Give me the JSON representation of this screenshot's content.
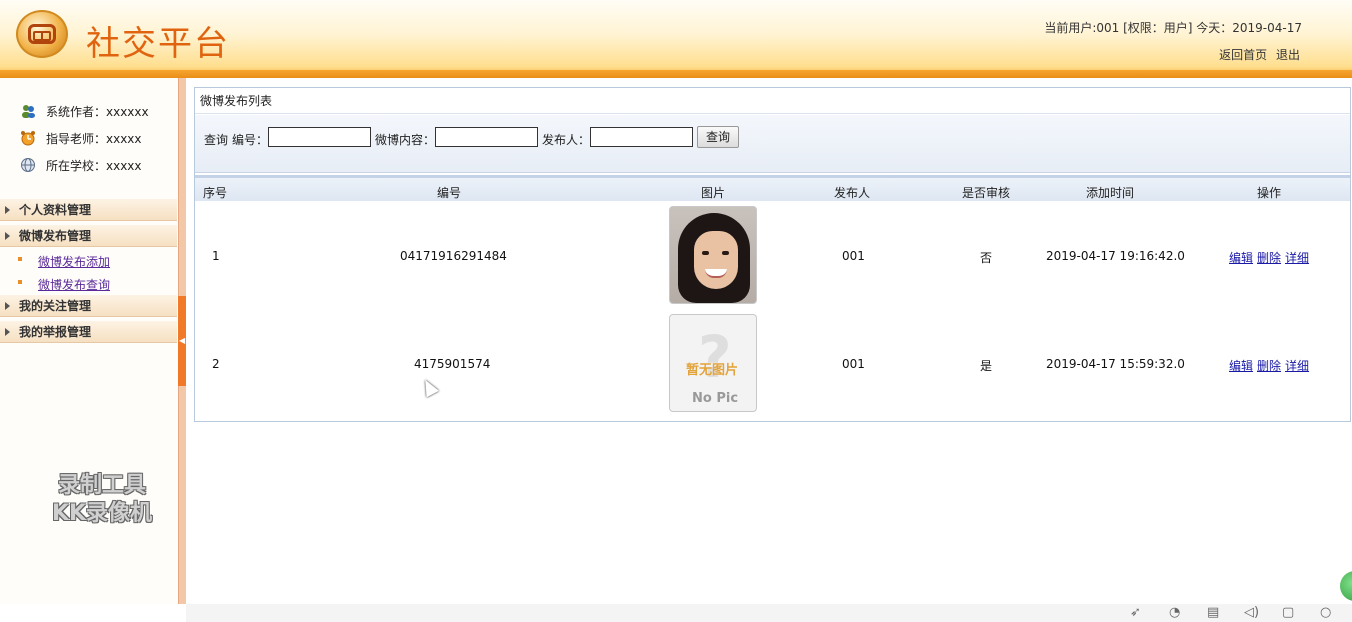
{
  "header": {
    "title": "社交平台",
    "user_info": "当前用户:001 [权限：用户] 今天：2019-04-17",
    "home_link": "返回首页",
    "logout_link": "退出"
  },
  "sidebar": {
    "author": "系统作者：xxxxxx",
    "teacher": "指导老师：xxxxx",
    "school": "所在学校：xxxxx",
    "menu": [
      {
        "label": "个人资料管理"
      },
      {
        "label": "微博发布管理",
        "children": [
          "微博发布添加",
          "微博发布查询"
        ]
      },
      {
        "label": "我的关注管理"
      },
      {
        "label": "我的举报管理"
      }
    ],
    "watermark_line1": "录制工具",
    "watermark_line2": "KK录像机"
  },
  "panel": {
    "title": "微博发布列表",
    "search": {
      "prefix": "查询",
      "field_id_label": "编号：",
      "field_content_label": "微博内容：",
      "field_publisher_label": "发布人：",
      "button": "查询",
      "field_id_value": "",
      "field_content_value": "",
      "field_publisher_value": ""
    },
    "columns": [
      "序号",
      "编号",
      "图片",
      "发布人",
      "是否审核",
      "添加时间",
      "操作"
    ],
    "rows": [
      {
        "seq": "1",
        "id": "04171916291484",
        "image": "photo",
        "publisher": "001",
        "reviewed": "否",
        "time": "2019-04-17 19:16:42.0"
      },
      {
        "seq": "2",
        "id": "4175901574",
        "image": "no-pic",
        "publisher": "001",
        "reviewed": "是",
        "time": "2019-04-17 15:59:32.0"
      }
    ],
    "actions": {
      "edit": "编辑",
      "delete": "删除",
      "detail": "详细"
    },
    "no_pic_text_cn": "暂无图片",
    "no_pic_text_en": "No Pic"
  },
  "colors": {
    "brand_orange": "#e0640f",
    "header_strip": "#f6a531",
    "link_blue": "#1a1aa6",
    "submenu_purple": "#5a2a9a"
  }
}
